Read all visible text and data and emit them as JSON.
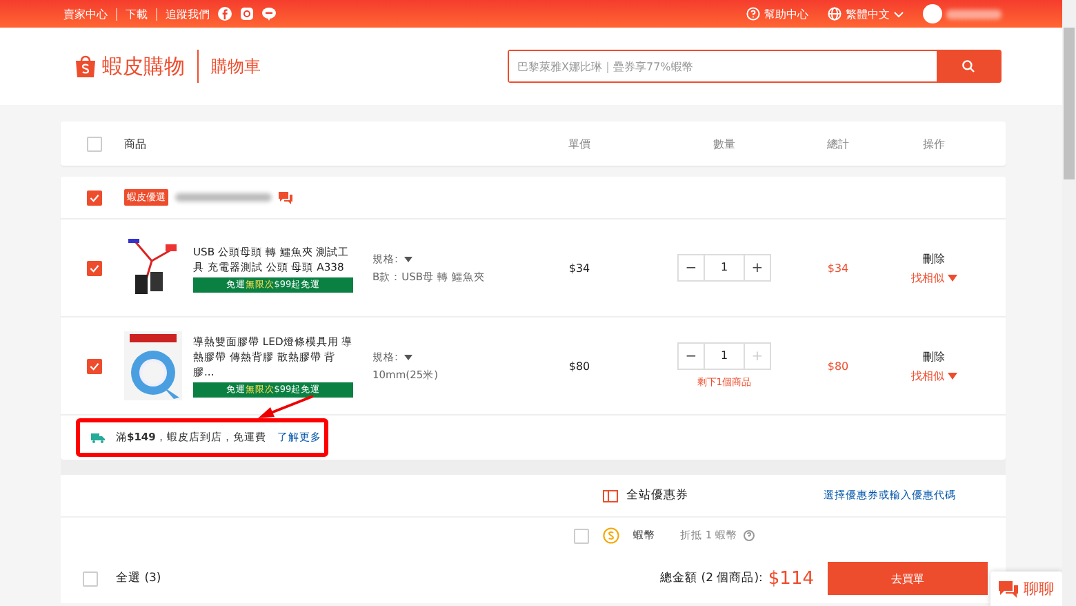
{
  "top_bar": {
    "left_links": [
      "賣家中心",
      "下載",
      "追蹤我們"
    ],
    "help": "幫助中心",
    "language": "繁體中文"
  },
  "header": {
    "logo": "蝦皮購物",
    "page_title": "購物車",
    "search": {
      "placeholder": "巴黎萊雅X娜比琳｜疊券享77%蝦幣"
    }
  },
  "table": {
    "select_all_checked": false,
    "columns": [
      "商品",
      "單價",
      "數量",
      "總計",
      "操作"
    ]
  },
  "shop": {
    "checked": true,
    "badge": "蝦皮優選"
  },
  "items": [
    {
      "checked": true,
      "kind": "picture",
      "name": "USB 公頭母頭 轉 鱷魚夾 測試工具 充電器測試 公頭 母頭 A338",
      "promo": [
        "免運",
        "無限次",
        "$99起免運"
      ],
      "variation_label": "規格:",
      "variation": "B款：USB母 轉 鱷魚夾",
      "price": "$34",
      "minus": "−",
      "quantity": "1",
      "plus": "+",
      "plus_disabled": false,
      "total": "$34",
      "delete": "刪除",
      "similar": "找相似"
    },
    {
      "checked": true,
      "kind": "picture",
      "name": "導熱雙面膠帶 LED燈條模具用 導熱膠帶 傳熱背膠 散熱膠帶 背膠...",
      "promo": [
        "免運",
        "無限次",
        "$99起免運"
      ],
      "variation_label": "規格:",
      "variation": "10mm(25米)",
      "price": "$80",
      "minus": "−",
      "quantity": "1",
      "plus": "+",
      "plus_disabled": true,
      "stock_note": "剩下1個商品",
      "total": "$80",
      "delete": "刪除",
      "similar": "找相似"
    }
  ],
  "shipping": {
    "text": "滿**$149**，蝦皮店到店，免運費",
    "link": "了解更多"
  },
  "voucher": {
    "label": "全站優惠券",
    "link": "選擇優惠券或輸入優惠代碼"
  },
  "coins": {
    "checked": false,
    "label": "蝦幣",
    "note": "折抵 1 蝦幣"
  },
  "footer": {
    "select_all_checked": false,
    "select_all": "全選 (3)",
    "total_label": "總金額 (2 個商品):",
    "total": "$114",
    "checkout": "去買單"
  },
  "chat": {
    "label": "聊聊"
  }
}
